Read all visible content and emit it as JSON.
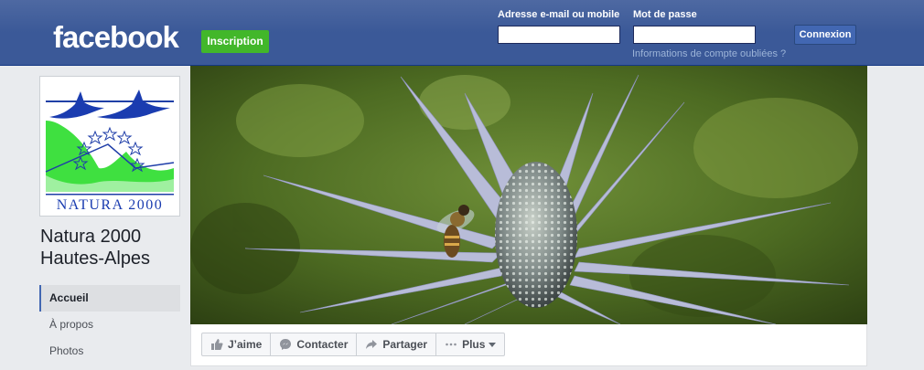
{
  "header": {
    "logo": "facebook",
    "signup_label": "Inscription",
    "email_label": "Adresse e-mail ou mobile",
    "email_value": "",
    "password_label": "Mot de passe",
    "password_value": "",
    "forgot_link": "Informations de compte oubliées ?",
    "login_label": "Connexion"
  },
  "profile": {
    "logo_text": "NATURA 2000",
    "name_line1": "Natura 2000",
    "name_line2": "Hautes-Alpes"
  },
  "nav": {
    "items": [
      {
        "label": "Accueil",
        "active": true
      },
      {
        "label": "À propos",
        "active": false
      },
      {
        "label": "Photos",
        "active": false
      }
    ]
  },
  "actions": {
    "like": "J’aime",
    "contact": "Contacter",
    "share": "Partager",
    "more": "Plus"
  },
  "colors": {
    "header_blue": "#3b5998",
    "signup_green": "#42b72a",
    "login_blue": "#4267b2",
    "page_bg": "#e9ebee"
  },
  "icons": {
    "like": "thumbs-up-icon",
    "contact": "messenger-icon",
    "share": "share-arrow-icon",
    "more": "dots-icon"
  }
}
